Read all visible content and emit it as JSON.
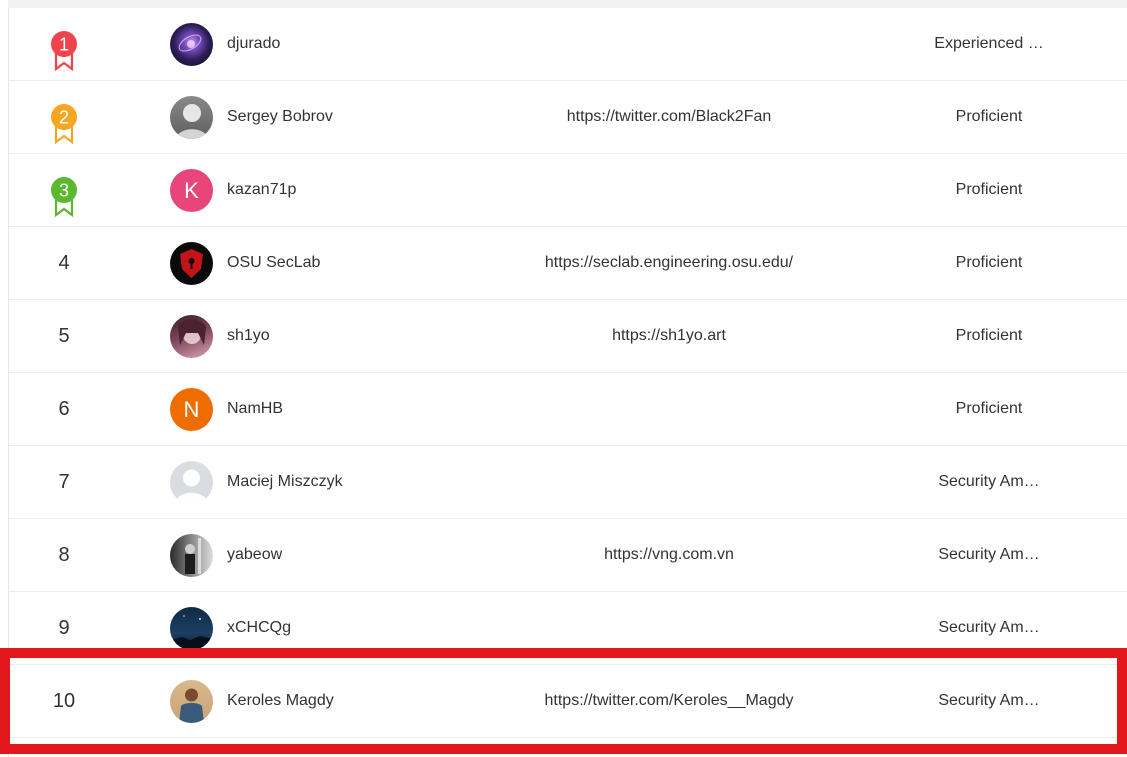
{
  "leaderboard": {
    "rows": [
      {
        "rank": "1",
        "name": "djurado",
        "url": "",
        "level": "Experienced …",
        "medal_color": "#f0444d",
        "avatar": "photo-nebula"
      },
      {
        "rank": "2",
        "name": "Sergey Bobrov",
        "url": "https://twitter.com/Black2Fan",
        "level": "Proficient",
        "medal_color": "#f5a623",
        "avatar": "photo-bw-portrait"
      },
      {
        "rank": "3",
        "name": "kazan71p",
        "url": "",
        "level": "Proficient",
        "medal_color": "#5cb82e",
        "avatar": "letter",
        "avatar_letter": "K",
        "avatar_color": "#e8457a"
      },
      {
        "rank": "4",
        "name": "OSU SecLab",
        "url": "https://seclab.engineering.osu.edu/",
        "level": "Proficient",
        "avatar": "photo-red-shield"
      },
      {
        "rank": "5",
        "name": "sh1yo",
        "url": "https://sh1yo.art",
        "level": "Proficient",
        "avatar": "photo-anime"
      },
      {
        "rank": "6",
        "name": "NamHB",
        "url": "",
        "level": "Proficient",
        "avatar": "letter",
        "avatar_letter": "N",
        "avatar_color": "#ef6c00"
      },
      {
        "rank": "7",
        "name": "Maciej Miszczyk",
        "url": "",
        "level": "Security Am…",
        "avatar": "default-user-icon"
      },
      {
        "rank": "8",
        "name": "yabeow",
        "url": "https://vng.com.vn",
        "level": "Security Am…",
        "avatar": "photo-bw-street"
      },
      {
        "rank": "9",
        "name": "xCHCQg",
        "url": "",
        "level": "Security Am…",
        "avatar": "photo-night-sky"
      },
      {
        "rank": "10",
        "name": "Keroles Magdy",
        "url": "https://twitter.com/Keroles__Magdy",
        "level": "Security Am…",
        "avatar": "photo-person"
      }
    ],
    "highlight_color": "#e3161c"
  }
}
